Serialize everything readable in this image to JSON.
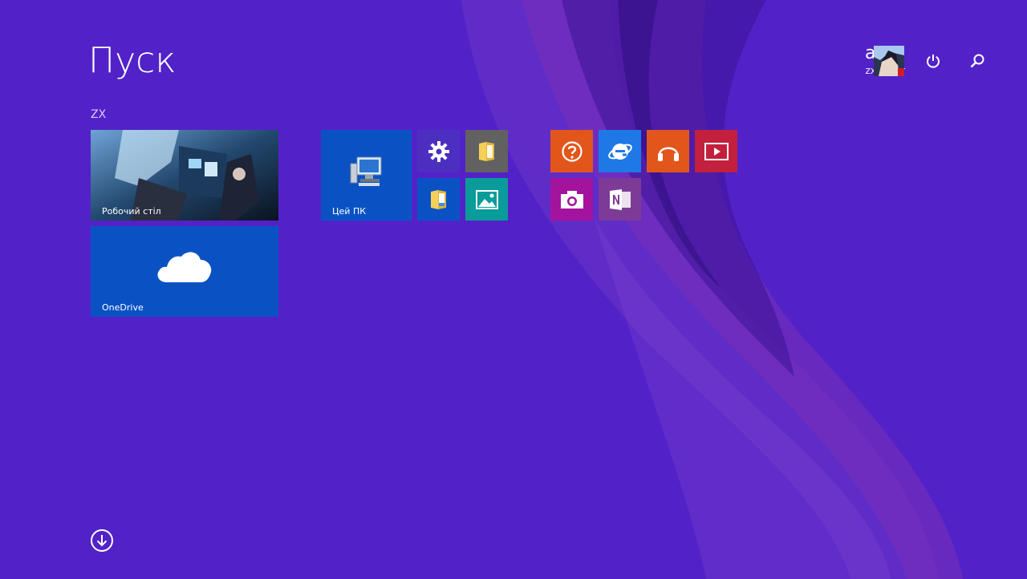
{
  "header": {
    "title": "Пуск"
  },
  "user": {
    "name": "aura",
    "account": "zxcqwer"
  },
  "groups": [
    {
      "label": "ZX"
    }
  ],
  "tiles": {
    "desktop": {
      "label": "Робочий стіл",
      "icon": "desktop-wallpaper-icon"
    },
    "onedrive": {
      "label": "OneDrive",
      "icon": "cloud-icon",
      "color": "#0a52c4"
    },
    "this_pc": {
      "label": "Цей ПК",
      "icon": "computer-icon",
      "color": "#0a52c4"
    },
    "settings": {
      "icon": "gear-icon",
      "color": "#4c2fc0"
    },
    "file_explorer": {
      "icon": "folder-icon",
      "color": "#616161"
    },
    "documents": {
      "icon": "folder-documents-icon",
      "color": "#0a52c4"
    },
    "photos": {
      "icon": "photos-icon",
      "color": "#0a9b9b"
    },
    "help": {
      "icon": "help-icon",
      "color": "#e2561c"
    },
    "internet_explorer": {
      "icon": "internet-explorer-icon",
      "color": "#1e78e6"
    },
    "music": {
      "icon": "headphones-icon",
      "color": "#e2561c"
    },
    "video": {
      "icon": "video-icon",
      "color": "#c2203c"
    },
    "camera": {
      "icon": "camera-icon",
      "color": "#a4139e"
    },
    "onenote": {
      "icon": "onenote-icon",
      "color": "#7d3b97"
    }
  },
  "colors": {
    "background": "#5222c8",
    "accent": "#0a52c4"
  }
}
